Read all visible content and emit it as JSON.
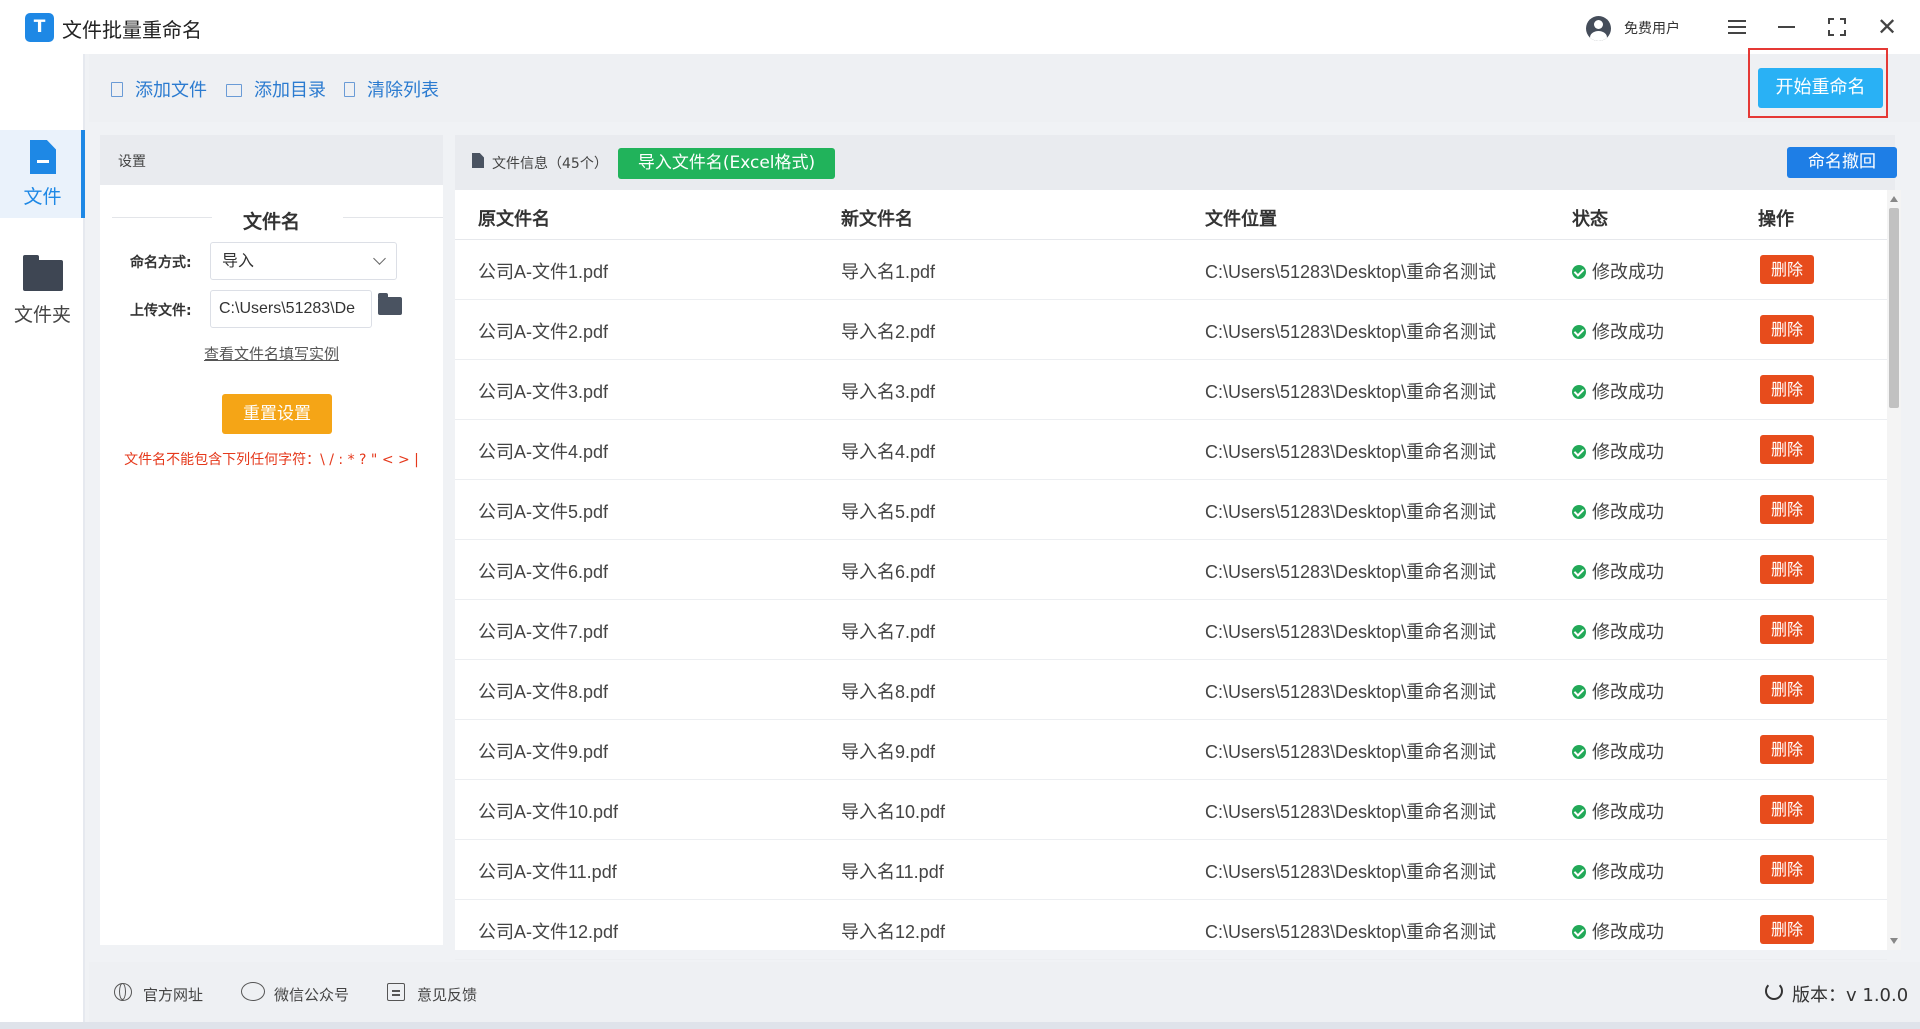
{
  "app": {
    "title": "文件批量重命名",
    "logo_letter": "T"
  },
  "titlebar": {
    "user_label": "免费用户",
    "icons": [
      "user-icon",
      "menu-icon",
      "minimize-icon",
      "maximize-icon",
      "close-icon"
    ]
  },
  "nav": {
    "file_label": "文件",
    "folder_label": "文件夹"
  },
  "toolbar": {
    "add_file": "添加文件",
    "add_dir": "添加目录",
    "clear_list": "清除列表",
    "start_rename": "开始重命名"
  },
  "settings": {
    "header": "设置",
    "section_title": "文件名",
    "naming_mode_label": "命名方式:",
    "naming_mode_value": "导入",
    "upload_label": "上传文件:",
    "upload_value": "C:\\Users\\51283\\De",
    "example_link": "查看文件名填写实例",
    "reset_button": "重置设置",
    "warning": "文件名不能包含下列任何字符：\\ / : * ? \" < > |"
  },
  "filepanel": {
    "title": "文件信息（45个）",
    "import_button": "导入文件名(Excel格式)",
    "undo_button": "命名撤回",
    "columns": [
      "原文件名",
      "新文件名",
      "文件位置",
      "状态",
      "操作"
    ],
    "rows": [
      {
        "orig": "公司A-文件1.pdf",
        "new": "导入名1.pdf",
        "location": "C:\\Users\\51283\\Desktop\\重命名测试",
        "status": "修改成功",
        "action": "删除"
      },
      {
        "orig": "公司A-文件2.pdf",
        "new": "导入名2.pdf",
        "location": "C:\\Users\\51283\\Desktop\\重命名测试",
        "status": "修改成功",
        "action": "删除"
      },
      {
        "orig": "公司A-文件3.pdf",
        "new": "导入名3.pdf",
        "location": "C:\\Users\\51283\\Desktop\\重命名测试",
        "status": "修改成功",
        "action": "删除"
      },
      {
        "orig": "公司A-文件4.pdf",
        "new": "导入名4.pdf",
        "location": "C:\\Users\\51283\\Desktop\\重命名测试",
        "status": "修改成功",
        "action": "删除"
      },
      {
        "orig": "公司A-文件5.pdf",
        "new": "导入名5.pdf",
        "location": "C:\\Users\\51283\\Desktop\\重命名测试",
        "status": "修改成功",
        "action": "删除"
      },
      {
        "orig": "公司A-文件6.pdf",
        "new": "导入名6.pdf",
        "location": "C:\\Users\\51283\\Desktop\\重命名测试",
        "status": "修改成功",
        "action": "删除"
      },
      {
        "orig": "公司A-文件7.pdf",
        "new": "导入名7.pdf",
        "location": "C:\\Users\\51283\\Desktop\\重命名测试",
        "status": "修改成功",
        "action": "删除"
      },
      {
        "orig": "公司A-文件8.pdf",
        "new": "导入名8.pdf",
        "location": "C:\\Users\\51283\\Desktop\\重命名测试",
        "status": "修改成功",
        "action": "删除"
      },
      {
        "orig": "公司A-文件9.pdf",
        "new": "导入名9.pdf",
        "location": "C:\\Users\\51283\\Desktop\\重命名测试",
        "status": "修改成功",
        "action": "删除"
      },
      {
        "orig": "公司A-文件10.pdf",
        "new": "导入名10.pdf",
        "location": "C:\\Users\\51283\\Desktop\\重命名测试",
        "status": "修改成功",
        "action": "删除"
      },
      {
        "orig": "公司A-文件11.pdf",
        "new": "导入名11.pdf",
        "location": "C:\\Users\\51283\\Desktop\\重命名测试",
        "status": "修改成功",
        "action": "删除"
      },
      {
        "orig": "公司A-文件12.pdf",
        "new": "导入名12.pdf",
        "location": "C:\\Users\\51283\\Desktop\\重命名测试",
        "status": "修改成功",
        "action": "删除"
      }
    ]
  },
  "footer": {
    "website": "官方网址",
    "wechat": "微信公众号",
    "feedback": "意见反馈",
    "version": "版本：v 1.0.0"
  },
  "colors": {
    "primary": "#1e88e5",
    "start_button": "#29b1f5",
    "import_button": "#21b35b",
    "reset_button": "#f5a516",
    "delete_button": "#e74c1c",
    "success": "#22a958",
    "highlight_frame": "#e53935"
  }
}
